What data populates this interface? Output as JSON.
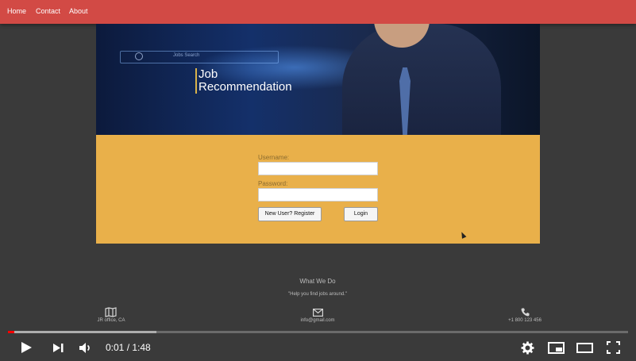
{
  "nav": {
    "items": [
      "Home",
      "Contact",
      "About"
    ]
  },
  "hero": {
    "search_text": "Jobs Search",
    "title_line1": "Job",
    "title_line2": "Recommendation"
  },
  "login": {
    "username_label": "Username:",
    "password_label": "Password:",
    "username_value": "",
    "password_value": "",
    "register_label": "New User? Register",
    "login_label": "Login"
  },
  "footer": {
    "heading": "What We Do",
    "tagline": "\"Help you find jobs around.\"",
    "location_text": "JR office, CA",
    "email_text": "info@gmail.com",
    "phone_text": "+1 800 123 456"
  },
  "player": {
    "progress": 0.01,
    "buffered": 0.24,
    "current_time": "0:01",
    "duration": "1:48",
    "time_display": "0:01 / 1:48",
    "accent": "#ff0000"
  }
}
